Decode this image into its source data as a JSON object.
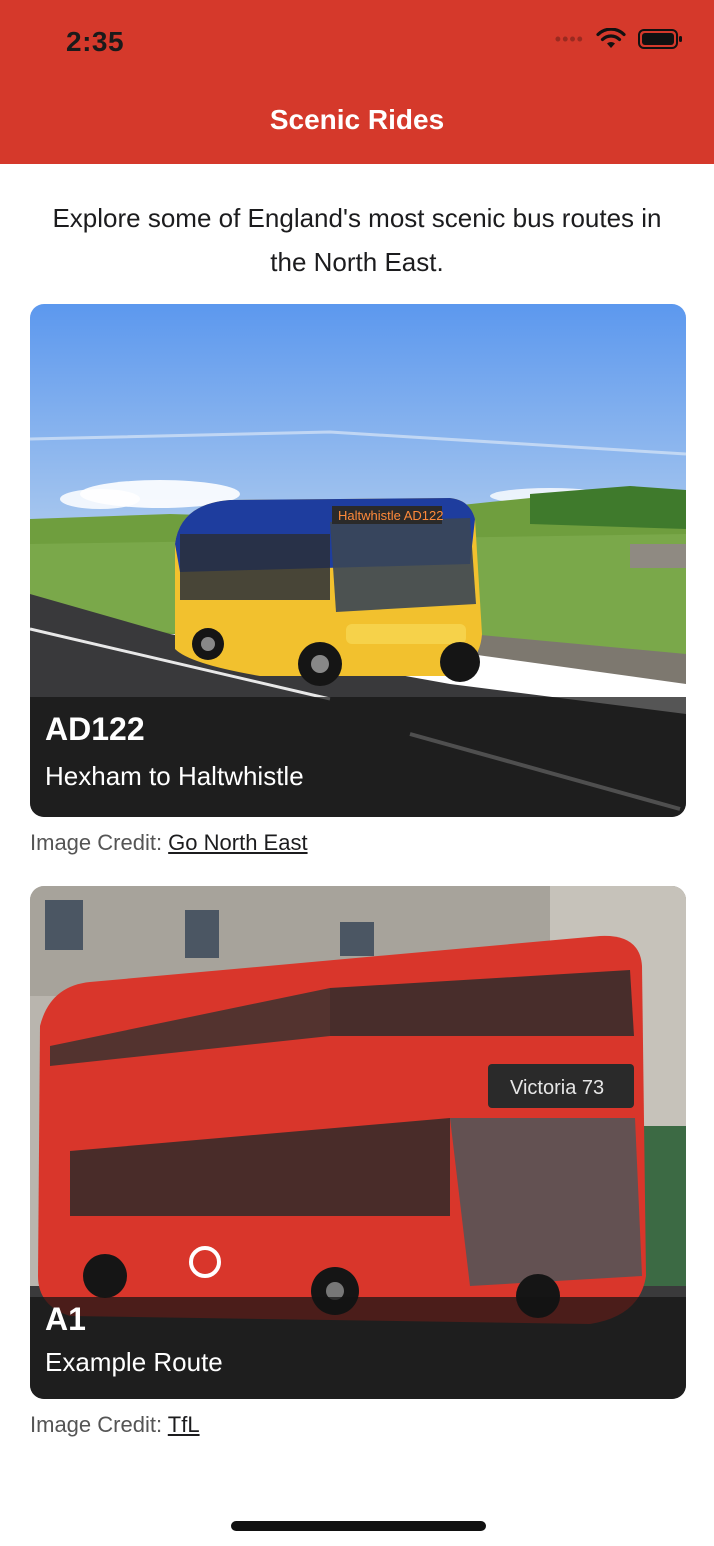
{
  "status_bar": {
    "time": "2:35",
    "icons": [
      "cellular-signal-icon",
      "wifi-icon",
      "battery-icon"
    ]
  },
  "nav": {
    "title": "Scenic Rides",
    "background": "#d5392b"
  },
  "intro": {
    "text": "Explore some of England's most scenic bus routes in the North East."
  },
  "routes": [
    {
      "number": "AD122",
      "name": "Hexham to Haltwhistle",
      "credit_prefix": "Image Credit: ",
      "credit_link": "Go North East"
    },
    {
      "number": "A1",
      "name": "Example Route",
      "credit_prefix": "Image Credit: ",
      "credit_link": "TfL"
    }
  ]
}
